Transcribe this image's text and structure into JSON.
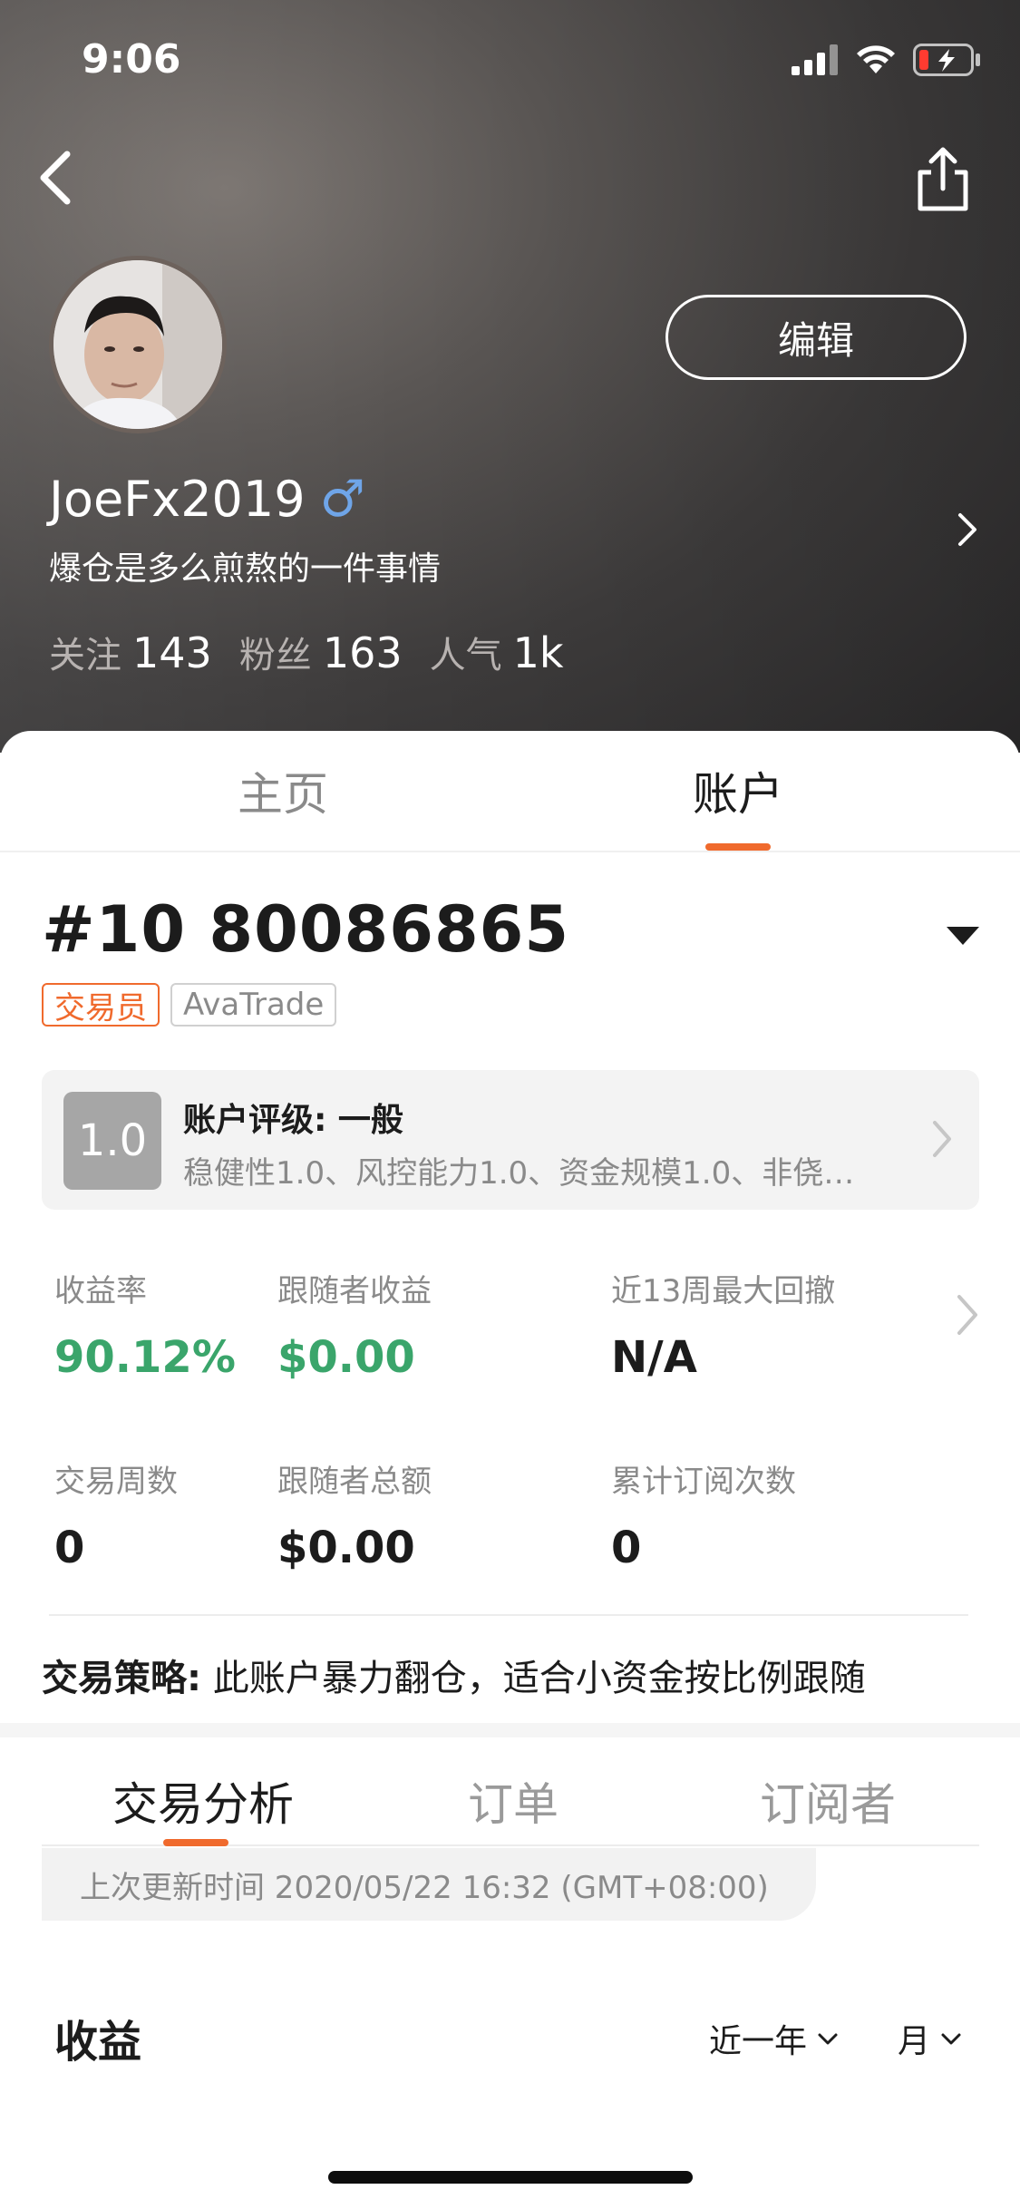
{
  "status_bar": {
    "time": "9:06"
  },
  "profile": {
    "username": "JoeFx2019",
    "gender_symbol": "♂",
    "bio": "爆仓是多么煎熬的一件事情",
    "edit_label": "编辑",
    "stats": [
      {
        "label": "关注",
        "value": "143"
      },
      {
        "label": "粉丝",
        "value": "163"
      },
      {
        "label": "人气",
        "value": "1k"
      }
    ]
  },
  "tabs": {
    "home": "主页",
    "account": "账户"
  },
  "account": {
    "number": "#10 80086865",
    "badges": {
      "trader": "交易员",
      "broker": "AvaTrade"
    },
    "rating": {
      "score": "1.0",
      "title": "账户评级: 一般",
      "detail": "稳健性1.0、风控能力1.0、资金规模1.0、非侥…"
    },
    "metrics": [
      {
        "label": "收益率",
        "value": "90.12%"
      },
      {
        "label": "跟随者收益",
        "value": "$0.00"
      },
      {
        "label": "近13周最大回撤",
        "value": "N/A"
      },
      {
        "label": "交易周数",
        "value": "0"
      },
      {
        "label": "跟随者总额",
        "value": "$0.00"
      },
      {
        "label": "累计订阅次数",
        "value": "0"
      }
    ],
    "strategy_label": "交易策略:",
    "strategy_text": " 此账户暴力翻仓，适合小资金按比例跟随"
  },
  "subtabs": {
    "analysis": "交易分析",
    "orders": "订单",
    "subscribers": "订阅者"
  },
  "update_time": "上次更新时间 2020/05/22 16:32 (GMT+08:00)",
  "income": {
    "title": "收益",
    "range": "近一年",
    "unit": "月"
  },
  "colors": {
    "accent": "#f06a2d",
    "positive": "#3aa56b",
    "gender": "#6fa5e8"
  }
}
